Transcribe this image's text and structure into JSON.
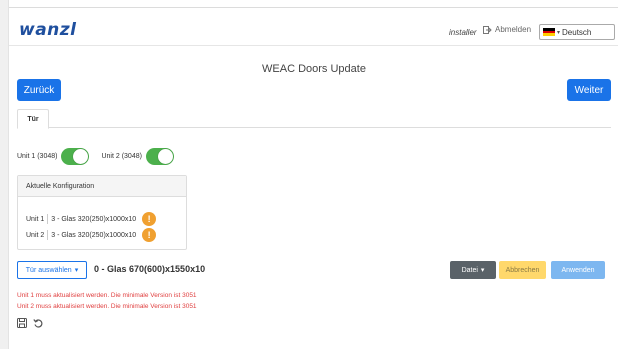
{
  "header": {
    "logo": "wanzl",
    "user": "installer",
    "logout_label": "Abmelden",
    "language": "Deutsch"
  },
  "page": {
    "title": "WEAC Doors Update",
    "back_label": "Zurück",
    "next_label": "Weiter"
  },
  "tabs": [
    {
      "label": "Tür"
    }
  ],
  "units": [
    {
      "label": "Unit 1 (3048)",
      "enabled": true
    },
    {
      "label": "Unit 2 (3048)",
      "enabled": true
    }
  ],
  "config": {
    "title": "Aktuelle Konfiguration",
    "rows": [
      {
        "unit": "Unit 1",
        "value": "3 - Glas 320(250)x1000x10",
        "warning": "!"
      },
      {
        "unit": "Unit 2",
        "value": "3 - Glas 320(250)x1000x10",
        "warning": "!"
      }
    ]
  },
  "selection": {
    "button_label": "Tür auswählen",
    "value": "0 - Glas 670(600)x1550x10"
  },
  "actions": {
    "file_label": "Datei",
    "cancel_label": "Abbrechen",
    "apply_label": "Anwenden"
  },
  "errors": [
    "Unit 1 muss aktualisiert werden. Die minimale Version ist 3051",
    "Unit 2 muss aktualisiert werden. Die minimale Version ist 3051"
  ],
  "icons": {
    "save": "save-icon",
    "undo": "undo-icon",
    "logout": "logout-icon",
    "flag": "flag-de-icon"
  },
  "colors": {
    "primary": "#1a73e8",
    "toggle_on": "#4cb04c",
    "warning": "#f0a030",
    "error": "#e04040",
    "cancel": "#ffd86b",
    "apply": "#7db7f0",
    "file": "#5a6268"
  }
}
